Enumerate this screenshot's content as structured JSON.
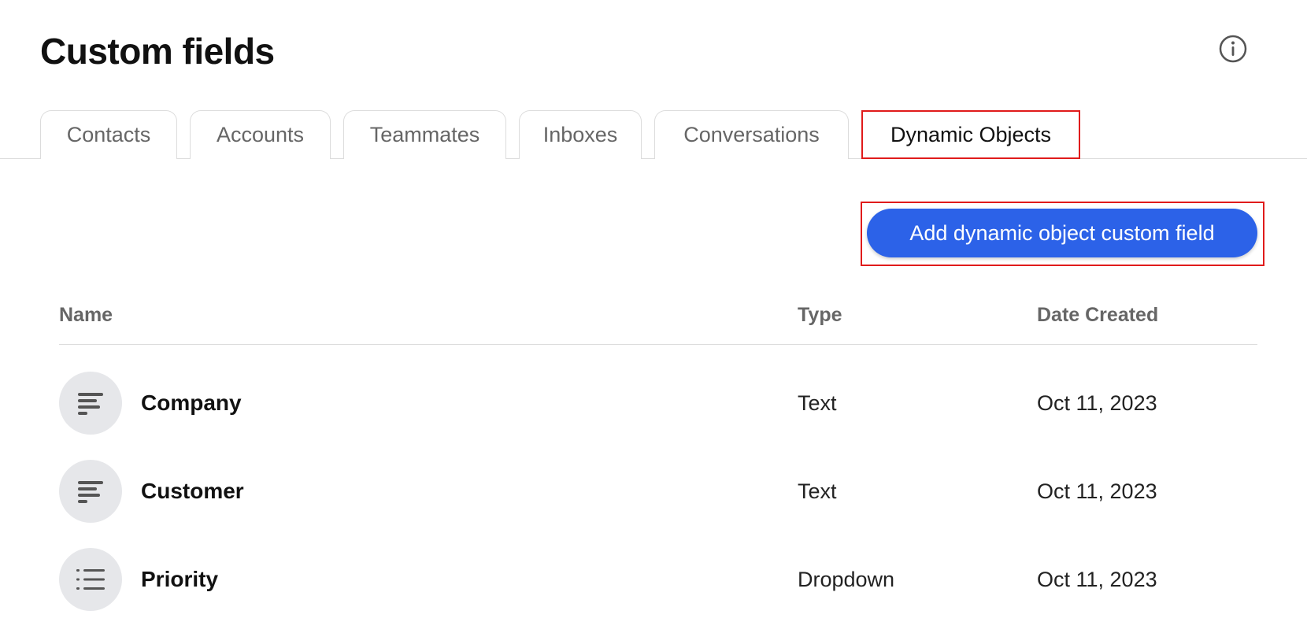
{
  "header": {
    "title": "Custom fields",
    "info_icon": "info-circle-icon"
  },
  "tabs": [
    {
      "label": "Contacts",
      "active": false
    },
    {
      "label": "Accounts",
      "active": false
    },
    {
      "label": "Teammates",
      "active": false
    },
    {
      "label": "Inboxes",
      "active": false
    },
    {
      "label": "Conversations",
      "active": false
    },
    {
      "label": "Dynamic Objects",
      "active": true
    }
  ],
  "toolbar": {
    "add_label": "Add dynamic object custom field"
  },
  "table": {
    "columns": {
      "name": "Name",
      "type": "Type",
      "date": "Date Created"
    },
    "rows": [
      {
        "name": "Company",
        "type": "Text",
        "date": "Oct 11, 2023",
        "icon": "text-lines-icon"
      },
      {
        "name": "Customer",
        "type": "Text",
        "date": "Oct 11, 2023",
        "icon": "text-lines-icon"
      },
      {
        "name": "Priority",
        "type": "Dropdown",
        "date": "Oct 11, 2023",
        "icon": "list-icon"
      }
    ]
  },
  "colors": {
    "primary": "#2c62e8",
    "highlight": "#e01b1b",
    "icon_bg": "#e6e7ea"
  }
}
